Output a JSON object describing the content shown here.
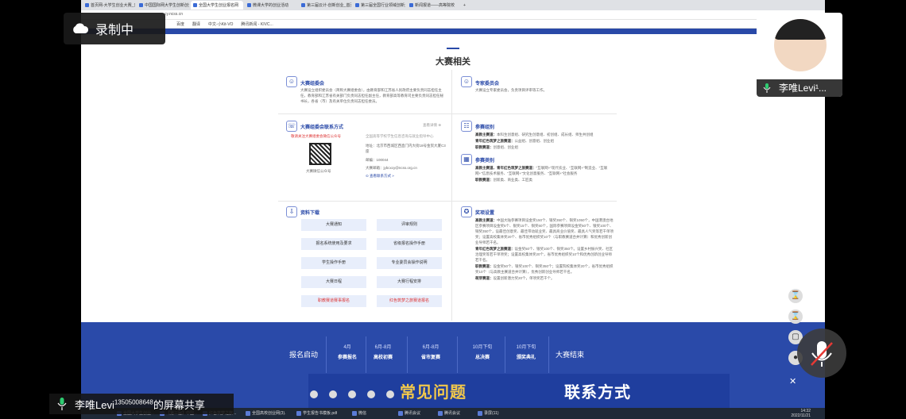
{
  "browser": {
    "tabs": [
      "首页网-大学生创业大赛_开...",
      "中国国际网大学生创新创业大...",
      "全国大学生创业报名网",
      "微课大学的创业活动",
      "第三届云计-创新创业_首页",
      "第三届全国行业领域创新大赛",
      "新闻报道——高等院校",
      "+"
    ],
    "url": "cy.ncss.cn",
    "bookmarks": [
      "百度",
      "翻译",
      "中文-小Kit-VO",
      "腾讯新闻 - KIVC..."
    ]
  },
  "page": {
    "section_title": "大赛相关",
    "panels": {
      "committee": {
        "title": "大赛组委会",
        "text": "大赛设立组织委员会（简称大赛组委会），由教育部和江苏省人民政府主要负责同志担任主任，教育部和江苏省有关部门负责同志担任副主任，教育部高等教育司主要负责同志担任秘书长，各省（市）及有关单位负责同志担任委员。"
      },
      "experts": {
        "title": "专家委员会",
        "text": "大赛设立专家委员会，负责项目评审等工作。"
      },
      "contact": {
        "title": "大赛组委会联系方式",
        "more": "查看详情 ⊕",
        "red_note": "敬请关注大赛组委会微信公众号",
        "qr_caption": "大赛微信公众号",
        "org": "全国高等学校学生信息咨询与就业指导中心",
        "address": "地址：北京市西城区西直门内大街18号金贸大厦C3座",
        "zip": "邮编：100044",
        "email": "大赛邮箱：jybcxcy@ncss.org.cn",
        "link": "⊙ 查看联系方式 »"
      },
      "groups": {
        "title": "参赛组别",
        "lines": [
          {
            "k": "高教主赛道：",
            "v": "本科生创意组、研究生创意组、初创组、成长组、师生共创组"
          },
          {
            "k": "青年红色筑梦之旅赛道：",
            "v": "公益组、创意组、创业组"
          },
          {
            "k": "职教赛道：",
            "v": "创意组、创业组"
          }
        ]
      },
      "categories": {
        "title": "参赛类别",
        "lines": [
          {
            "k": "高教主赛道、青年红色筑梦之旅赛道：",
            "v": "\"互联网+\"现代农业、\"互联网+\"制造业、\"互联网+\"信息技术服务、\"互联网+\"文化创意服务、\"互联网+\"社会服务"
          },
          {
            "k": "职教赛道：",
            "v": "创新类、商业类、工匠类"
          }
        ]
      },
      "downloads": {
        "title": "资料下载",
        "buttons": [
          {
            "label": "大赛通知",
            "red": false
          },
          {
            "label": "评审规则",
            "red": false
          },
          {
            "label": "报名系统使用及要求",
            "red": false
          },
          {
            "label": "省级报名操作手册",
            "red": false
          },
          {
            "label": "学生操作手册",
            "red": false
          },
          {
            "label": "专业委员会操作说明",
            "red": false
          },
          {
            "label": "大赛日程",
            "red": false
          },
          {
            "label": "大赛行程安排",
            "red": false
          },
          {
            "label": "职教赛道赛事报名",
            "red": true
          },
          {
            "label": "红色筑梦之旅赛道报名",
            "red": true
          }
        ]
      },
      "awards": {
        "title": "奖项设置",
        "lines": [
          {
            "k": "高教主赛道：",
            "v": "中国大陆参赛项目设金奖150个、银奖350个、铜奖1050个，中国港澳台地区参赛项目设金奖5个、银奖15个、铜奖60个，国际参赛项目设金奖50个、银奖100个、铜奖350个，设最佳创意奖、最佳带动就业奖、最具商业价值奖、最具人气奖等若干单项奖；设置高校集体奖20个、省市优秀组织奖10个（与职教赛道合并计算）和优秀创新创业导师若干名。"
          },
          {
            "k": "青年红色筑梦之旅赛道：",
            "v": "设金奖50个、银奖100个、铜奖350个。设置乡村振兴奖、社区治理奖等若干单项奖；设置高校集体奖20个，省市优秀组织奖10个和优秀创新创业导师若干名。"
          },
          {
            "k": "职教赛道：",
            "v": "设金奖50个、银奖100个、铜奖350个；设置院校集体奖20个，省市优秀组织奖10个（与高教主赛道合并计算），优秀创新创业导师若干名。"
          },
          {
            "k": "萌芽赛道：",
            "v": "设置创新潜力奖20个，单项奖若干个。"
          }
        ]
      }
    },
    "timeline": [
      {
        "top": "报名启动",
        "bottom": "",
        "big": true
      },
      {
        "top": "4月",
        "bottom": "参赛报名",
        "big": false
      },
      {
        "top": "6月-8月",
        "bottom": "高校初赛",
        "big": false
      },
      {
        "top": "6月-8月",
        "bottom": "省市复赛",
        "big": false
      },
      {
        "top": "10月下旬",
        "bottom": "总决赛",
        "big": false
      },
      {
        "top": "10月下旬",
        "bottom": "颁奖典礼",
        "big": false
      },
      {
        "top": "大赛结束",
        "bottom": "",
        "big": true
      }
    ],
    "banner": {
      "left": "常见问题",
      "right": "联系方式"
    }
  },
  "taskbar": {
    "items": [
      "全国大学生创业...",
      "【第三届】中国...",
      "红色筑梦之旅...",
      "全国高校创业网(3)...",
      "学生报告书模板.pdf...",
      "微信",
      "腾讯会议",
      "腾讯会议",
      "录屏(11)"
    ],
    "time": "14:32",
    "date": "2022/11/21"
  },
  "overlays": {
    "recording": "录制中",
    "camera_name": "李唯Levi¹...",
    "share_name": "李唯Levi",
    "share_suffix": "13505008648",
    "share_text": "的屏幕共享"
  },
  "colors": {
    "brand_blue": "#2949a8",
    "banner_yellow": "#f2c84b",
    "red_text": "#dd3333"
  }
}
